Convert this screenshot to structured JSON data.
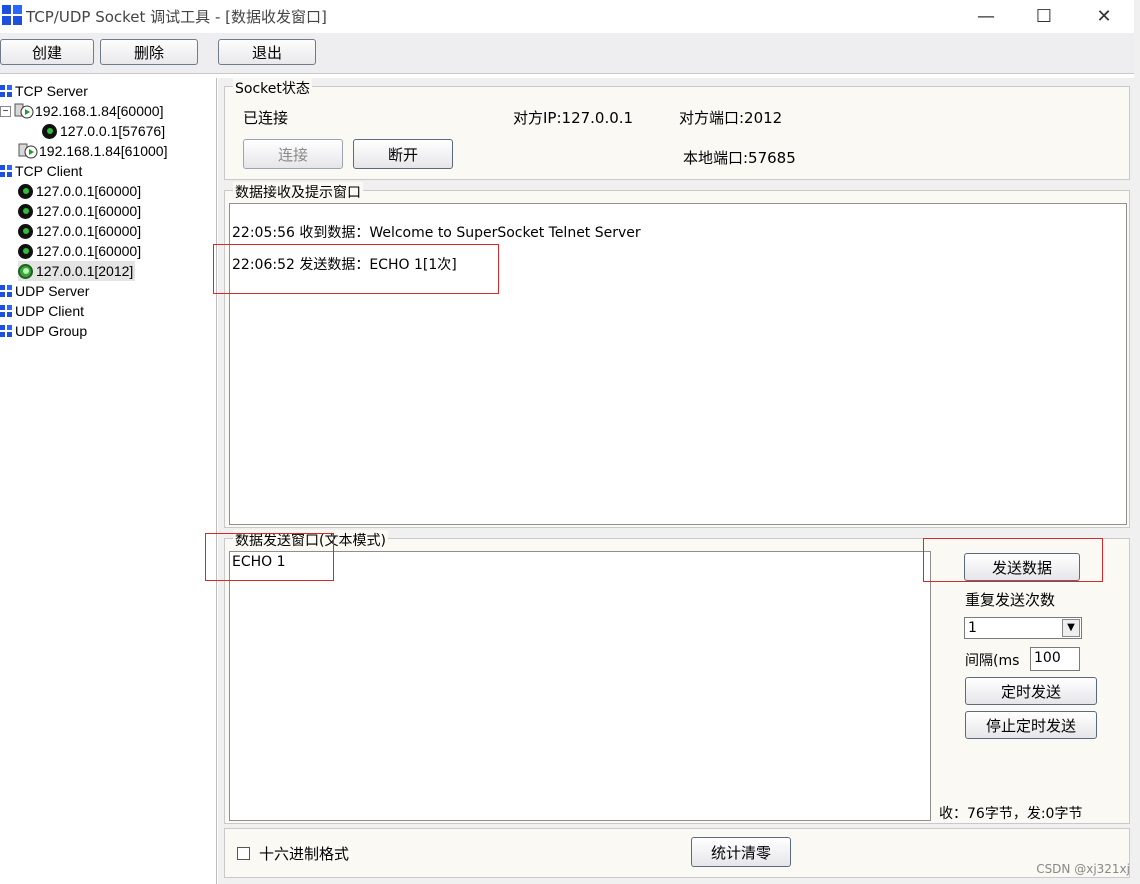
{
  "window": {
    "title": "TCP/UDP Socket 调试工具 - [数据收发窗口]",
    "controls": {
      "minimize": "—",
      "maximize": "☐",
      "close": "✕"
    }
  },
  "toolbar": {
    "create_label": "创建",
    "delete_label": "删除",
    "exit_label": "退出"
  },
  "tree": {
    "tcp_server": "TCP Server",
    "server_1": "192.168.1.84[60000]",
    "server_1_child": "127.0.0.1[57676]",
    "server_2": "192.168.1.84[61000]",
    "tcp_client": "TCP Client",
    "clients": [
      "127.0.0.1[60000]",
      "127.0.0.1[60000]",
      "127.0.0.1[60000]",
      "127.0.0.1[60000]",
      "127.0.0.1[2012]"
    ],
    "udp_server": "UDP Server",
    "udp_client": "UDP Client",
    "udp_group": "UDP Group"
  },
  "socket_status": {
    "legend": "Socket状态",
    "state": "已连接",
    "remote_ip": "对方IP:127.0.0.1",
    "remote_port": "对方端口:2012",
    "local_port": "本地端口:57685",
    "connect_label": "连接",
    "disconnect_label": "断开"
  },
  "receive": {
    "legend": "数据接收及提示窗口",
    "lines": [
      "22:05:56 收到数据：Welcome to SuperSocket Telnet Server",
      "22:06:52 发送数据：ECHO 1[1次]"
    ]
  },
  "send": {
    "legend": "数据发送窗口(文本模式)",
    "text": "ECHO 1",
    "send_button": "发送数据",
    "repeat_label": "重复发送次数",
    "repeat_value": "1",
    "interval_label": "间隔(ms",
    "interval_value": "100",
    "timer_send": "定时发送",
    "timer_stop": "停止定时发送",
    "stats": "收：76字节，发:0字节"
  },
  "bottom": {
    "hex_label": "十六进制格式",
    "reset_stats": "统计清零"
  },
  "watermark": "CSDN @xj321xj",
  "colors": {
    "highlight": "#d42a2a",
    "accent": "#1d4fe0"
  }
}
